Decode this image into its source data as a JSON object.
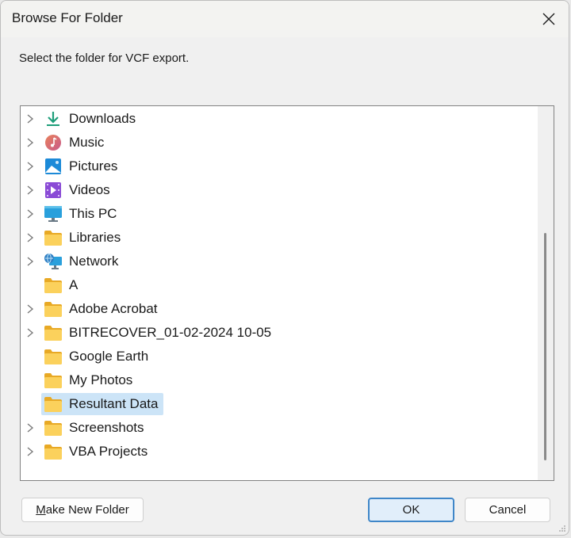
{
  "dialog": {
    "title": "Browse For Folder",
    "prompt": "Select the folder for VCF export."
  },
  "tree": {
    "items": [
      {
        "label": "Downloads",
        "icon": "download-icon",
        "expandable": true
      },
      {
        "label": "Music",
        "icon": "music-icon",
        "expandable": true
      },
      {
        "label": "Pictures",
        "icon": "pictures-icon",
        "expandable": true
      },
      {
        "label": "Videos",
        "icon": "videos-icon",
        "expandable": true
      },
      {
        "label": "This PC",
        "icon": "computer-icon",
        "expandable": true
      },
      {
        "label": "Libraries",
        "icon": "folder-icon",
        "expandable": true
      },
      {
        "label": "Network",
        "icon": "network-icon",
        "expandable": true
      },
      {
        "label": "A",
        "icon": "folder-icon",
        "expandable": false
      },
      {
        "label": "Adobe Acrobat",
        "icon": "folder-icon",
        "expandable": true
      },
      {
        "label": "BITRECOVER_01-02-2024 10-05",
        "icon": "folder-icon",
        "expandable": true
      },
      {
        "label": "Google Earth",
        "icon": "folder-icon",
        "expandable": false
      },
      {
        "label": "My Photos",
        "icon": "folder-icon",
        "expandable": false
      },
      {
        "label": "Resultant Data",
        "icon": "folder-icon",
        "expandable": false,
        "selected": true
      },
      {
        "label": "Screenshots",
        "icon": "folder-icon",
        "expandable": true
      },
      {
        "label": "VBA Projects",
        "icon": "folder-icon",
        "expandable": true
      }
    ]
  },
  "buttons": {
    "make_new_folder_mnemonic": "M",
    "make_new_folder_rest": "ake New Folder",
    "ok": "OK",
    "cancel": "Cancel"
  },
  "colors": {
    "selection": "#cce4f7",
    "ok_border": "#3f86c8",
    "folder": "#f8c94a"
  }
}
